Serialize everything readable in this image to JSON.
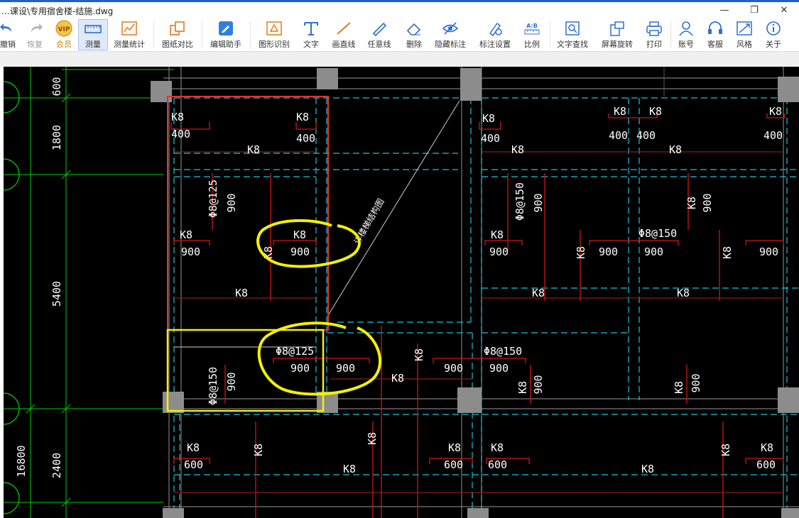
{
  "window": {
    "title": "…课设\\专用宿舍楼-结施.dwg",
    "controls": [
      "—",
      "❐",
      "✕"
    ]
  },
  "toolbar": {
    "items": [
      {
        "label": "撤销",
        "icon": "undo-icon"
      },
      {
        "label": "恢复",
        "icon": "redo-icon"
      },
      {
        "label": "会员",
        "icon": "vip-icon",
        "badge": "VIP"
      },
      {
        "label": "测量",
        "icon": "measure-icon",
        "active": true
      },
      {
        "label": "测量统计",
        "icon": "measure-stats-icon"
      },
      {
        "label": "图纸对比",
        "icon": "compare-icon"
      },
      {
        "label": "编辑助手",
        "icon": "edit-assistant-icon"
      },
      {
        "label": "图形识别",
        "icon": "shape-recognition-icon"
      },
      {
        "label": "文字",
        "icon": "text-icon"
      },
      {
        "label": "画直线",
        "icon": "line-icon"
      },
      {
        "label": "任意线",
        "icon": "freehand-icon"
      },
      {
        "label": "删除",
        "icon": "eraser-icon"
      },
      {
        "label": "隐藏标注",
        "icon": "hide-annotation-icon"
      },
      {
        "label": "标注设置",
        "icon": "annotation-settings-icon"
      },
      {
        "label": "比例",
        "icon": "scale-icon"
      },
      {
        "label": "文字查找",
        "icon": "text-search-icon"
      },
      {
        "label": "屏幕旋转",
        "icon": "rotate-screen-icon"
      },
      {
        "label": "打印",
        "icon": "print-icon"
      },
      {
        "label": "账号",
        "icon": "account-icon"
      },
      {
        "label": "客服",
        "icon": "support-icon"
      },
      {
        "label": "风格",
        "icon": "style-icon"
      },
      {
        "label": "关于",
        "icon": "about-icon"
      }
    ]
  },
  "drawing": {
    "dimensions": [
      "600",
      "1800",
      "5400",
      "2400",
      "16800"
    ],
    "rebar": {
      "k8": "K8",
      "phi8_125": "Φ8@125",
      "phi8_150": "Φ8@150",
      "v400": "400",
      "v600": "600",
      "v900": "900"
    },
    "diagonal_note": "详楼梯结构图",
    "colors": {
      "background": "#000000",
      "column": "#8c8c8c",
      "dim_line": "#00cc00",
      "dashed_beam": "#19c3d6",
      "rebar": "#d01515",
      "text": "#ffffff",
      "highlight_red": "#e83030",
      "highlight_yellow": "#f4f000"
    }
  }
}
